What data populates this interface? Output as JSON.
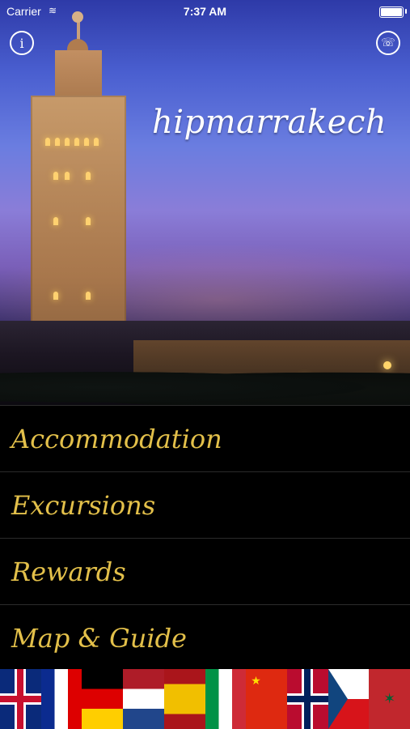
{
  "status": {
    "carrier": "Carrier",
    "time": "7:37 AM"
  },
  "hero": {
    "brand": "hipmarrakech"
  },
  "icons": {
    "info": "info-icon",
    "call": "phone-icon",
    "wifi": "wifi-icon",
    "battery": "battery-icon"
  },
  "menu": {
    "items": [
      {
        "label": "Accommodation"
      },
      {
        "label": "Excursions"
      },
      {
        "label": "Rewards"
      },
      {
        "label": "Map & Guide"
      }
    ]
  },
  "flags": [
    "uk",
    "fr",
    "de",
    "nl",
    "es",
    "it",
    "cn",
    "no",
    "cz",
    "ma"
  ],
  "colors": {
    "menu_text": "#e3c04a",
    "menu_bg": "#000000"
  }
}
